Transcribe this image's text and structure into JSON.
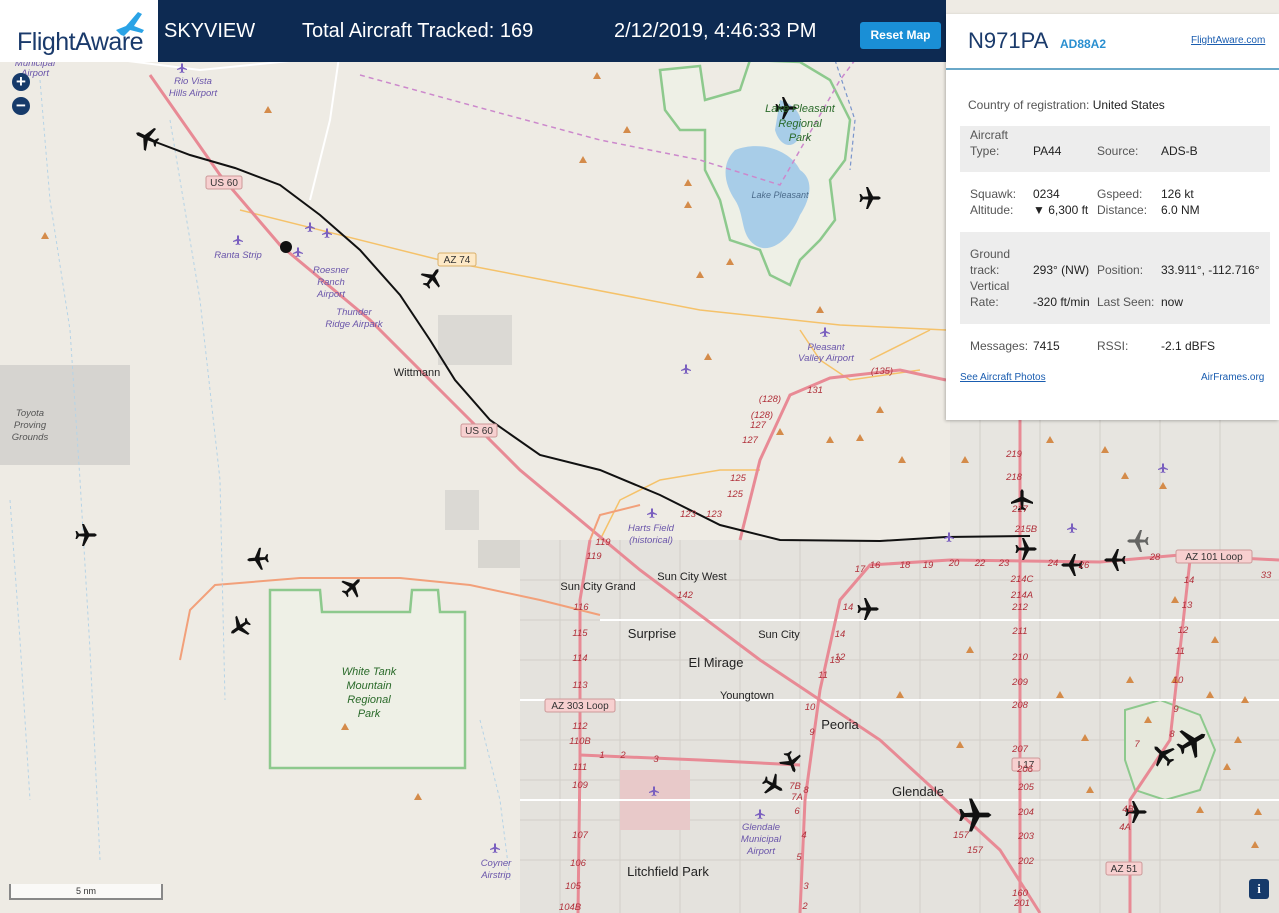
{
  "header": {
    "logo_text": "FlightAware",
    "app_name": "SKYVIEW",
    "total_tracked": "Total Aircraft Tracked: 169",
    "datetime": "2/12/2019, 4:46:33 PM",
    "reset_label": "Reset Map"
  },
  "panel": {
    "registration": "N971PA",
    "hex": "AD88A2",
    "site_link": "FlightAware.com",
    "country_label": "Country of registration:",
    "country_value": "United States",
    "aircraft_type_label_1": "Aircraft",
    "aircraft_type_label_2": "Type:",
    "aircraft_type_value": "PA44",
    "source_label": "Source:",
    "source_value": "ADS-B",
    "squawk_label": "Squawk:",
    "squawk_value": "0234",
    "gspeed_label": "Gspeed:",
    "gspeed_value": "126 kt",
    "altitude_label": "Altitude:",
    "altitude_value": "▼ 6,300 ft",
    "distance_label": "Distance:",
    "distance_value": "6.0 NM",
    "ground_label_1": "Ground",
    "ground_label_2": "track:",
    "ground_value": "293° (NW)",
    "position_label": "Position:",
    "position_value": "33.911°, -112.716°",
    "vrate_label_1": "Vertical",
    "vrate_label_2": "Rate:",
    "vrate_value": "-320 ft/min",
    "lastseen_label": "Last Seen:",
    "lastseen_value": "now",
    "messages_label": "Messages:",
    "messages_value": "7415",
    "rssi_label": "RSSI:",
    "rssi_value": "-2.1 dBFS",
    "photos_link": "See Aircraft Photos",
    "airframes_link": "AirFrames.org"
  },
  "map": {
    "zoom_in": "+",
    "zoom_out": "−",
    "scale_label": "5 nm",
    "info_button": "i",
    "places": {
      "surprise": "Surprise",
      "el_mirage": "El Mirage",
      "peoria": "Peoria",
      "glendale": "Glendale",
      "litchfield_park": "Litchfield Park",
      "sun_city": "Sun City",
      "sun_city_west": "Sun City West",
      "sun_city_grand": "Sun City Grand",
      "youngtown": "Youngtown",
      "wittmann": "Wittmann"
    },
    "pois": {
      "rio_vista_1": "Rio Vista",
      "rio_vista_2": "Hills Airport",
      "municipal": "Municipal",
      "airport_top": "Airport",
      "ranta": "Ranta Strip",
      "roesner_1": "Roesner",
      "roesner_2": "Ranch",
      "roesner_3": "Airport",
      "thunder_1": "Thunder",
      "thunder_2": "Ridge Airpark",
      "toyota_1": "Toyota",
      "toyota_2": "Proving",
      "toyota_3": "Grounds",
      "lake_pleasant_park_1": "Lake Pleasant",
      "lake_pleasant_park_2": "Regional",
      "lake_pleasant_park_3": "Park",
      "lake_pleasant": "Lake Pleasant",
      "pleasant_valley_1": "Pleasant",
      "pleasant_valley_2": "Valley Airport",
      "harts_1": "Harts Field",
      "harts_2": "(historical)",
      "white_tank_1": "White Tank",
      "white_tank_2": "Mountain",
      "white_tank_3": "Regional",
      "white_tank_4": "Park",
      "glendale_airport_1": "Glendale",
      "glendale_airport_2": "Municipal",
      "glendale_airport_3": "Airport",
      "coyner_1": "Coyner",
      "coyner_2": "Airstrip"
    },
    "shields": {
      "us60_top": "US 60",
      "us60_mid": "US 60",
      "az74": "AZ 74",
      "az303": "AZ 303 Loop",
      "az101": "AZ 101 Loop",
      "i17": "I 17",
      "az51": "AZ 51"
    },
    "exits": {
      "e128a": "(128)",
      "e128b": "(128)",
      "e127a": "127",
      "e127b": "127",
      "e125a": "125",
      "e125b": "125",
      "e123a": "123",
      "e123b": "123",
      "e119a": "119",
      "e119b": "119",
      "e116": "116",
      "e115": "115",
      "e114": "114",
      "e113": "113",
      "e112": "112",
      "e110b": "110B",
      "e111": "111",
      "e109": "109",
      "e107": "107",
      "e106": "106",
      "e105": "105",
      "e104b": "104B",
      "e1": "1",
      "e2": "2",
      "e3": "3",
      "e131": "131",
      "e135": "(135)",
      "e142": "142",
      "e17": "17",
      "e16": "16",
      "e18": "18",
      "e19": "19",
      "e20": "20",
      "e22": "22",
      "e23": "23",
      "e24": "24",
      "e26": "26",
      "e28": "28",
      "e33": "33",
      "e218": "218",
      "e219": "219",
      "e217": "217",
      "e215b": "215B",
      "e214c": "214C",
      "e214a": "214A",
      "e212": "212",
      "e211": "211",
      "e210": "210",
      "e209": "209",
      "e208": "208",
      "e207": "207",
      "e206": "206",
      "e205": "205",
      "e204": "204",
      "e203": "203",
      "e202": "202",
      "e201": "201",
      "e160": "160",
      "e157a": "157",
      "e157b": "157",
      "e14a": "14",
      "e14b": "14",
      "e13": "13",
      "e12": "12",
      "e11": "11",
      "e10": "10",
      "e9": "9",
      "e8": "8",
      "e7b": "7B",
      "e7a": "7A",
      "e6": "6",
      "e5": "5",
      "e4": "4",
      "e4a": "4A",
      "e4b": "4B",
      "e3b": "3",
      "e2b": "2",
      "e14c": "14",
      "e13b": "13",
      "e12b": "12",
      "e11b": "11",
      "e10b": "10",
      "e9b": "9",
      "e8b": "8",
      "e7": "7"
    }
  },
  "colors": {
    "header_bg": "#0d2a52",
    "accent": "#1a8fd6",
    "route": "#111111",
    "highway": "#e88a95",
    "park_border": "#8dc98d"
  }
}
